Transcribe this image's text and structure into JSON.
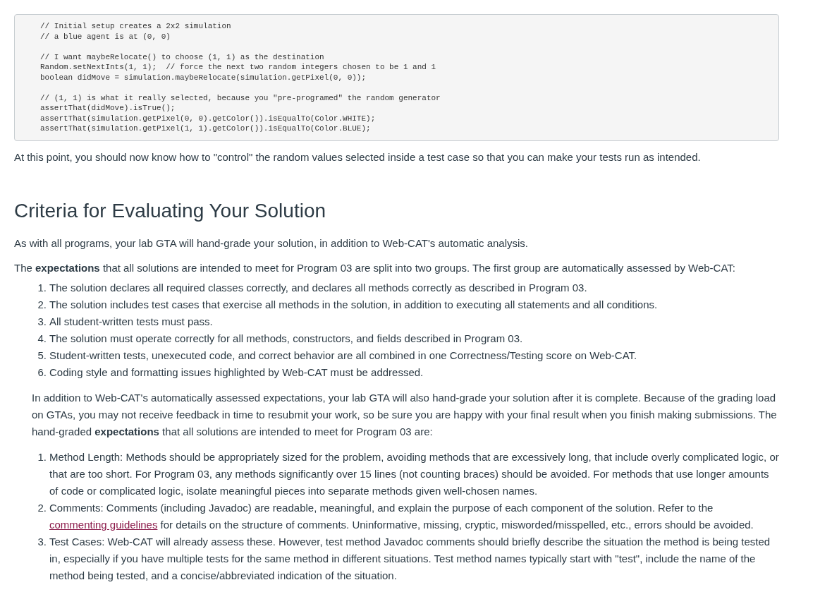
{
  "code_block": {
    "groups": [
      [
        "// Initial setup creates a 2x2 simulation",
        "// a blue agent is at (0, 0)"
      ],
      [
        "// I want maybeRelocate() to choose (1, 1) as the destination",
        "Random.setNextInts(1, 1);  // force the next two random integers chosen to be 1 and 1",
        "boolean didMove = simulation.maybeRelocate(simulation.getPixel(0, 0));"
      ],
      [
        "// (1, 1) is what it really selected, because you \"pre-programed\" the random generator",
        "assertThat(didMove).isTrue();",
        "assertThat(simulation.getPixel(0, 0).getColor()).isEqualTo(Color.WHITE);",
        "assertThat(simulation.getPixel(1, 1).getColor()).isEqualTo(Color.BLUE);"
      ]
    ]
  },
  "paragraph_1": "At this point, you should now know how to \"control\" the random values selected inside a test case so that you can make your tests run as intended.",
  "heading": "Criteria for Evaluating Your Solution",
  "paragraph_2": "As with all programs, your lab GTA will hand-grade your solution, in addition to Web-CAT's automatic analysis.",
  "paragraph_3": "The **expectations** that all solutions are intended to meet for Program 03 are split into two groups. The first group are automatically assessed by Web-CAT:",
  "list_1": [
    {
      "number": "1.",
      "text": "The solution declares all required classes correctly, and declares all methods correctly as described in Program 03."
    },
    {
      "number": "2.",
      "text": "The solution includes test cases that exercise all methods in the solution, in addition to executing all statements and all conditions."
    },
    {
      "number": "3.",
      "text": "All student-written tests must pass."
    },
    {
      "number": "4.",
      "text": "The solution must operate correctly for all methods, constructors, and fields described in Program 03."
    },
    {
      "number": "5.",
      "text": "Student-written tests, unexecuted code, and correct behavior are all combined in one Correctness/Testing score on Web-CAT."
    },
    {
      "number": "6.",
      "text": "Coding style and formatting issues highlighted by Web-CAT must be addressed."
    }
  ],
  "paragraph_4": "In addition to Web-CAT's automatically assessed expectations, your lab GTA will also hand-grade your solution after it is complete. Because of the grading load on GTAs, you may not receive feedback in time to resubmit your work, so be sure you are happy with your final result when you finish making submissions. The hand-graded **expectations** that all solutions are intended to meet for Program 03 are:",
  "list_2": [
    {
      "number": "1.",
      "text": "Method Length: Methods should be appropriately sized for the problem, avoiding methods that are excessively long, that include overly complicated logic, or that are too short. For Program 03, any methods significantly over 15 lines (not counting braces) should be avoided. For methods that use longer amounts of code or complicated logic, isolate meaningful pieces into separate methods given well-chosen names."
    },
    {
      "number": "2.",
      "text": "Comments: Comments (including Javadoc) are readable, meaningful, and explain the purpose of each component of the solution. Refer to the",
      "link": "commenting guidelines",
      "text_after": "for details on the structure of comments. Uninformative, missing, cryptic, misworded/misspelled, etc., errors should be avoided."
    },
    {
      "number": "3.",
      "text": "Test Cases: Web-CAT will already assess these. However, test method Javadoc comments should briefly describe the situation the method is being tested in, especially if you have multiple tests for the same method in different situations. Test method names typically start with \"test\", include the name of the method being tested, and a concise/abbreviated indication of the situation."
    }
  ]
}
